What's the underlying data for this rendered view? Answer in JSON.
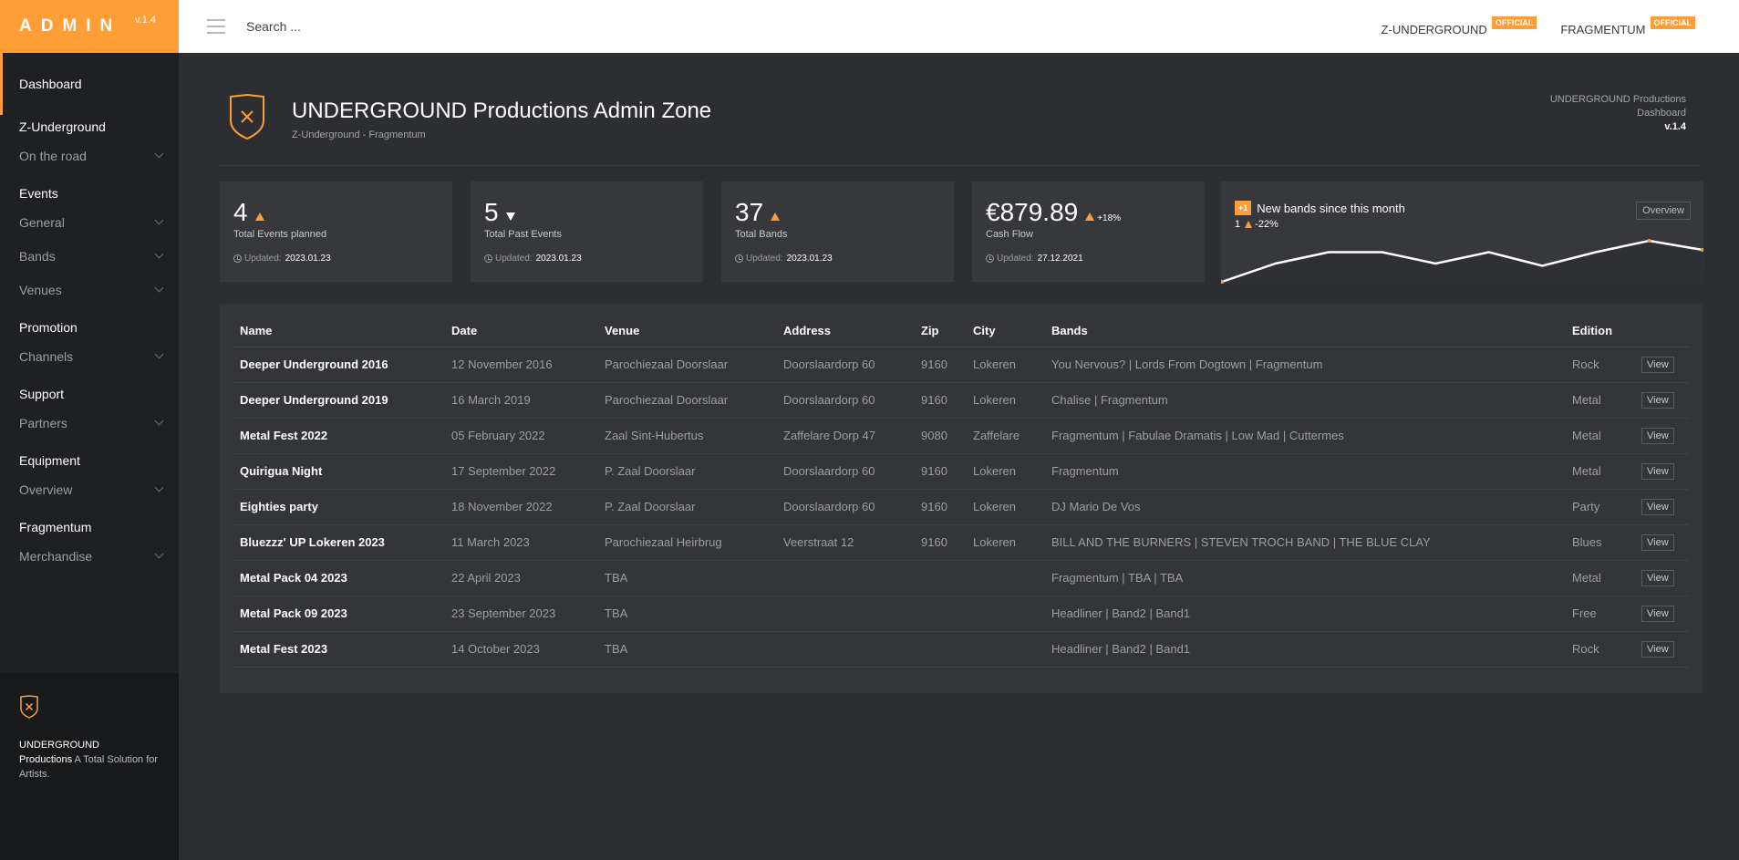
{
  "brand": {
    "title": "ADMIN",
    "version": "v.1.4"
  },
  "topbar": {
    "search_placeholder": "Search ...",
    "orgs": [
      {
        "name": "Z-UNDERGROUND",
        "badge": "OFFICIAL"
      },
      {
        "name": "FRAGMENTUM",
        "badge": "OFFICIAL"
      }
    ]
  },
  "sidebar": {
    "dashboard": "Dashboard",
    "sections": [
      {
        "title": "Z-Underground",
        "items": [
          "On the road"
        ]
      },
      {
        "title": "Events",
        "items": [
          "General",
          "Bands",
          "Venues"
        ]
      },
      {
        "title": "Promotion",
        "items": [
          "Channels"
        ]
      },
      {
        "title": "Support",
        "items": [
          "Partners"
        ]
      },
      {
        "title": "Equipment",
        "items": [
          "Overview"
        ]
      },
      {
        "title": "Fragmentum",
        "items": [
          "Merchandise"
        ]
      }
    ],
    "footer": {
      "name_line1": "UNDERGROUND",
      "name_line2": "Productions",
      "tagline": "A Total Solution for Artists."
    }
  },
  "header": {
    "title": "UNDERGROUND Productions Admin Zone",
    "subtitle": "Z-Underground - Fragmentum",
    "right_line1": "UNDERGROUND Productions",
    "right_line2": "Dashboard",
    "right_version": "v.1.4"
  },
  "stats": [
    {
      "value": "4",
      "trend": "up",
      "pct": "",
      "label": "Total Events planned",
      "updated_label": "Updated:",
      "updated": "2023.01.23"
    },
    {
      "value": "5",
      "trend": "down",
      "pct": "",
      "label": "Total Past Events",
      "updated_label": "Updated:",
      "updated": "2023.01.23"
    },
    {
      "value": "37",
      "trend": "up",
      "pct": "",
      "label": "Total Bands",
      "updated_label": "Updated:",
      "updated": "2023.01.23"
    },
    {
      "value": "€879.89",
      "trend": "up",
      "pct": "+18%",
      "label": "Cash Flow",
      "updated_label": "Updated:",
      "updated": "27.12.2021"
    }
  ],
  "new_bands": {
    "badge": "+1",
    "title": "New bands since this month",
    "count": "1",
    "pct": "-22%",
    "button": "Overview",
    "line_color": "#ffffff",
    "accent": "#ff9d36"
  },
  "chart_data": {
    "type": "line",
    "values": [
      0,
      8,
      13,
      13,
      8,
      13,
      7,
      13,
      18,
      14
    ]
  },
  "table": {
    "columns": [
      "Name",
      "Date",
      "Venue",
      "Address",
      "Zip",
      "City",
      "Bands",
      "Edition",
      ""
    ],
    "view_label": "View",
    "rows": [
      {
        "name": "Deeper Underground 2016",
        "date": "12 November 2016",
        "venue": "Parochiezaal Doorslaar",
        "address": "Doorslaardorp 60",
        "zip": "9160",
        "city": "Lokeren",
        "bands": "You Nervous? | Lords From Dogtown | Fragmentum",
        "edition": "Rock"
      },
      {
        "name": "Deeper Underground 2019",
        "date": "16 March 2019",
        "venue": "Parochiezaal Doorslaar",
        "address": "Doorslaardorp 60",
        "zip": "9160",
        "city": "Lokeren",
        "bands": "Chalise | Fragmentum",
        "edition": "Metal"
      },
      {
        "name": "Metal Fest 2022",
        "date": "05 February 2022",
        "venue": "Zaal Sint-Hubertus",
        "address": "Zaffelare Dorp 47",
        "zip": "9080",
        "city": "Zaffelare",
        "bands": "Fragmentum | Fabulae Dramatis | Low Mad | Cuttermes",
        "edition": "Metal"
      },
      {
        "name": "Quirigua Night",
        "date": "17 September 2022",
        "venue": "P. Zaal Doorslaar",
        "address": "Doorslaardorp 60",
        "zip": "9160",
        "city": "Lokeren",
        "bands": "Fragmentum",
        "edition": "Metal"
      },
      {
        "name": "Eighties party",
        "date": "18 November 2022",
        "venue": "P. Zaal Doorslaar",
        "address": "Doorslaardorp 60",
        "zip": "9160",
        "city": "Lokeren",
        "bands": "DJ Mario De Vos",
        "edition": "Party"
      },
      {
        "name": "Bluezzz' UP Lokeren 2023",
        "date": "11 March 2023",
        "venue": "Parochiezaal Heirbrug",
        "address": "Veerstraat 12",
        "zip": "9160",
        "city": "Lokeren",
        "bands": "BILL AND THE BURNERS | STEVEN TROCH BAND | THE BLUE CLAY",
        "edition": "Blues"
      },
      {
        "name": "Metal Pack 04 2023",
        "date": "22 April 2023",
        "venue": "TBA",
        "address": "",
        "zip": "",
        "city": "",
        "bands": "Fragmentum | TBA | TBA",
        "edition": "Metal"
      },
      {
        "name": "Metal Pack 09 2023",
        "date": "23 September 2023",
        "venue": "TBA",
        "address": "",
        "zip": "",
        "city": "",
        "bands": "Headliner | Band2 | Band1",
        "edition": "Free"
      },
      {
        "name": "Metal Fest 2023",
        "date": "14 October 2023",
        "venue": "TBA",
        "address": "",
        "zip": "",
        "city": "",
        "bands": "Headliner | Band2 | Band1",
        "edition": "Rock"
      }
    ]
  }
}
